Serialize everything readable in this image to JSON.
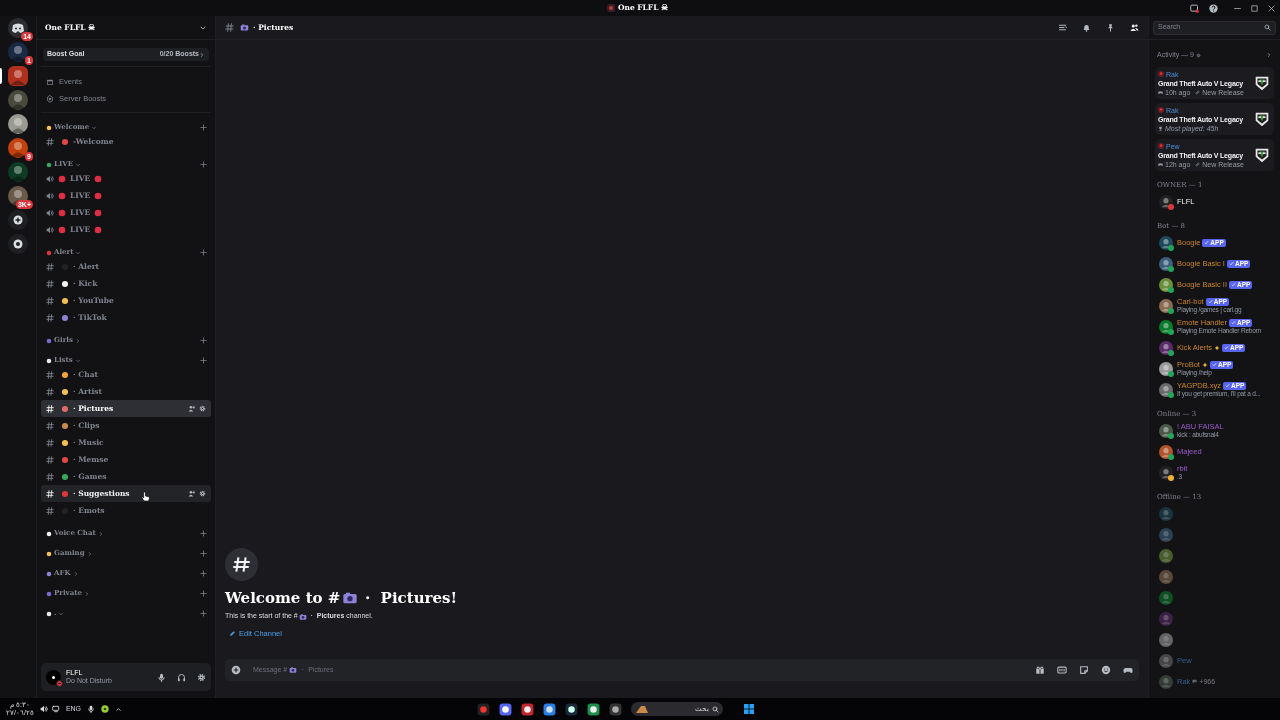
{
  "title_bar": {
    "title": "One FLFL ☠"
  },
  "servers": [
    {
      "kind": "home",
      "badge": "14",
      "selected": false
    },
    {
      "kind": "server",
      "badge": "1",
      "selected": false
    },
    {
      "kind": "server",
      "selected": true
    },
    {
      "kind": "server",
      "selected": false
    },
    {
      "kind": "server",
      "selected": false
    },
    {
      "kind": "server",
      "badge": "9",
      "selected": false
    },
    {
      "kind": "server",
      "selected": false
    },
    {
      "kind": "server",
      "badge": "3K+",
      "selected": false
    },
    {
      "kind": "add",
      "selected": false
    },
    {
      "kind": "discover",
      "selected": false
    }
  ],
  "sidebar": {
    "server_name": "One FLFL ☠",
    "boost_goal": {
      "label": "Boost Goal",
      "progress": "0/20 Boosts"
    },
    "links": [
      {
        "kind": "events",
        "label": "Events"
      },
      {
        "kind": "boosts",
        "label": "Server Boosts"
      }
    ],
    "categories": [
      {
        "name": "Welcome",
        "expanded": true,
        "channels": [
          {
            "kind": "text",
            "name": "-Welcome",
            "selected": false,
            "hovered": false
          }
        ]
      },
      {
        "name": "LIVE",
        "expanded": true,
        "channels": [
          {
            "kind": "voice",
            "name": "LIVE",
            "selected": false,
            "hovered": false
          },
          {
            "kind": "voice",
            "name": "LIVE",
            "selected": false,
            "hovered": false
          },
          {
            "kind": "voice",
            "name": "LIVE",
            "selected": false,
            "hovered": false
          },
          {
            "kind": "voice",
            "name": "LIVE",
            "selected": false,
            "hovered": false
          }
        ]
      },
      {
        "name": "Alert",
        "expanded": true,
        "channels": [
          {
            "kind": "text",
            "name": "· Alert",
            "selected": false,
            "hovered": false
          },
          {
            "kind": "text",
            "name": "· Kick",
            "selected": false,
            "hovered": false
          },
          {
            "kind": "text",
            "name": "· YouTube",
            "selected": false,
            "hovered": false
          },
          {
            "kind": "text",
            "name": "· TikTok",
            "selected": false,
            "hovered": false
          }
        ]
      },
      {
        "name": "Girls",
        "expanded": false
      },
      {
        "name": "Lists",
        "expanded": true,
        "channels": [
          {
            "kind": "text",
            "name": "· Chat",
            "selected": false,
            "hovered": false
          },
          {
            "kind": "text",
            "name": "· Artist",
            "selected": false,
            "hovered": false
          },
          {
            "kind": "text",
            "name": "· Pictures",
            "selected": true,
            "hovered": false
          },
          {
            "kind": "text",
            "name": "· Clips",
            "selected": false,
            "hovered": false
          },
          {
            "kind": "text",
            "name": "· Music",
            "selected": false,
            "hovered": false
          },
          {
            "kind": "text",
            "name": "· Memse",
            "selected": false,
            "hovered": false
          },
          {
            "kind": "text",
            "name": "· Games",
            "selected": false,
            "hovered": false
          },
          {
            "kind": "text",
            "name": "· Suggestions",
            "selected": false,
            "hovered": true
          },
          {
            "kind": "text",
            "name": "· Emots",
            "selected": false,
            "hovered": false
          }
        ]
      },
      {
        "name": "Voice Chat",
        "expanded": false
      },
      {
        "name": "Gaming",
        "expanded": false
      },
      {
        "name": "AFK",
        "expanded": false
      },
      {
        "name": "Private",
        "expanded": false
      },
      {
        "name": ".",
        "expanded": true
      }
    ]
  },
  "user_panel": {
    "name": "FLFL",
    "status": "Do Not Disturb"
  },
  "channel_header": {
    "name": "· Pictures"
  },
  "search": {
    "placeholder": "Search"
  },
  "welcome": {
    "heading_start": "Welcome to #",
    "heading_end": "・ Pictures!",
    "subtitle_start": "This is the start of the #",
    "subtitle_end": "・ **Pictures** channel.",
    "edit_link": "Edit Channel"
  },
  "message_box": {
    "prompt_start": "Message #",
    "prompt_end": "・ Pictures"
  },
  "activity": {
    "title": "Activity — 9",
    "cards": [
      {
        "kind": "recent",
        "user": "Rak",
        "game": "Grand Theft Auto V Legacy",
        "time": "10h ago",
        "tag": "New Release"
      },
      {
        "kind": "played",
        "user": "Rak",
        "game": "Grand Theft Auto V Legacy",
        "time": "Most played: 45h"
      },
      {
        "kind": "recent",
        "user": "Pew",
        "game": "Grand Theft Auto V Legacy",
        "time": "12h ago",
        "tag": "New Release"
      }
    ]
  },
  "member_sections": [
    {
      "title": "OWNER — 1",
      "members": [
        {
          "kind": "owner",
          "name": "FLFL",
          "online": true,
          "color": "#da373c"
        }
      ]
    },
    {
      "title": "Bot — 8",
      "members": [
        {
          "kind": "bot",
          "name": "Boogie",
          "online": true,
          "color": "#23a55a",
          "badge": "APP"
        },
        {
          "kind": "bot",
          "name": "Boogie Basic I",
          "online": true,
          "color": "#23a55a",
          "badge": "APP"
        },
        {
          "kind": "bot",
          "name": "Boogie Basic II",
          "online": true,
          "color": "#23a55a",
          "badge": "APP"
        },
        {
          "kind": "bot",
          "name": "Carl-bot",
          "online": true,
          "color": "#23a55a",
          "badge": "APP",
          "activity": "Playing /games | carl.gg"
        },
        {
          "kind": "bot",
          "name": "Emote Handler",
          "online": true,
          "color": "#23a55a",
          "badge": "APP",
          "activity": "Playing Emote Handler Reborn"
        },
        {
          "kind": "bot",
          "name": "Kick Alerts",
          "online": true,
          "color": "#23a55a",
          "emoji": true,
          "badge": "APP"
        },
        {
          "kind": "bot",
          "name": "ProBot",
          "online": true,
          "color": "#23a55a",
          "emoji": true,
          "badge": "APP",
          "activity": "Playing /help"
        },
        {
          "kind": "bot",
          "name": "YAGPDB.xyz",
          "online": true,
          "color": "#23a55a",
          "badge": "APP",
          "activity": "If you get premium, I'll pat a d..."
        }
      ]
    },
    {
      "title": "Online — 3",
      "members": [
        {
          "kind": "vip",
          "name": "! ABU FAISAL",
          "online": true,
          "color": "#23a55a",
          "activity": "kick : abufsnal4"
        },
        {
          "kind": "vip",
          "name": "Majeed",
          "online": true,
          "color": "#23a55a"
        },
        {
          "kind": "vip",
          "name": "rbit",
          "online": true,
          "color": "#f0b232",
          "activity": ".3"
        }
      ]
    },
    {
      "title": "Offline — 13",
      "members": [
        {
          "online": false
        },
        {
          "online": false
        },
        {
          "online": false
        },
        {
          "online": false
        },
        {
          "online": false
        },
        {
          "online": false
        },
        {
          "online": false
        },
        {
          "kind": "member",
          "name": "Pew",
          "online": false
        },
        {
          "kind": "member",
          "name": "Rak",
          "online": false,
          "tag": "+966"
        }
      ]
    }
  ],
  "taskbar": {
    "time": "٥:٣٠ م",
    "date": "٢٧/٠٦/٢٥",
    "language": "ENG",
    "search": "بحث"
  }
}
